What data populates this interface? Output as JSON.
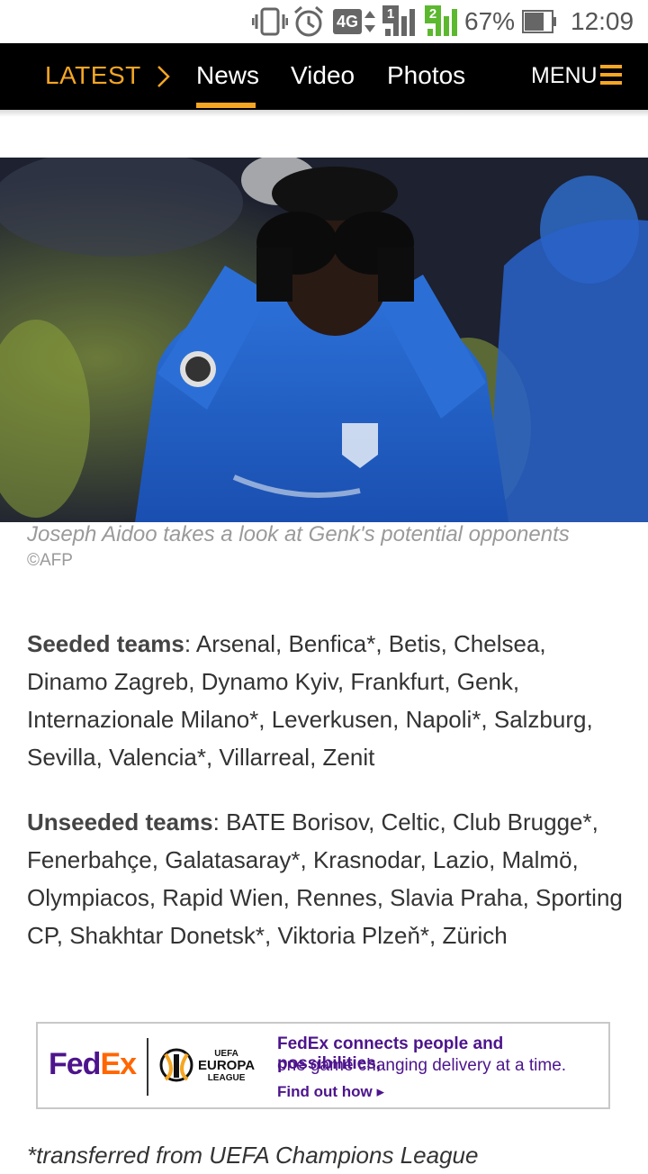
{
  "status_bar": {
    "battery_percent": "67%",
    "time": "12:09",
    "network": "4G",
    "sim1_badge": "1",
    "sim2_badge": "2",
    "icons": [
      "vibrate-icon",
      "alarm-icon",
      "network-4g-icon",
      "signal-sim1-icon",
      "signal-sim2-icon",
      "battery-icon"
    ]
  },
  "nav": {
    "latest": "LATEST",
    "tabs": [
      {
        "label": "News",
        "active": true
      },
      {
        "label": "Video",
        "active": false
      },
      {
        "label": "Photos",
        "active": false
      }
    ],
    "menu": "MENU",
    "accent_color": "#f5a623"
  },
  "hero": {
    "caption": "Joseph Aidoo takes a look at Genk's potential opponents",
    "credit": "©AFP"
  },
  "article": {
    "seeded_label": "Seeded teams",
    "seeded_text": ": Arsenal, Benfica*, Betis, Chelsea, Dinamo Zagreb, Dynamo Kyiv, Frankfurt, Genk, Internazionale Milano*, Leverkusen, Napoli*, Salzburg, Sevilla, Valencia*, Villarreal, Zenit",
    "unseeded_label": "Unseeded teams",
    "unseeded_text": ": BATE Borisov, Celtic, Club Brugge*, Fenerbahçe, Galatasaray*, Krasnodar, Lazio, Malmö, Olympiacos, Rapid Wien, Rennes, Slavia Praha, Sporting CP, Shakhtar Donetsk*, Viktoria Plzeň*, Zürich",
    "footnote": "*transferred from UEFA Champions League"
  },
  "ad": {
    "brand_fed": "Fed",
    "brand_ex": "Ex",
    "uel_small": "UEFA",
    "uel_big": "EUROPA",
    "uel_league": "LEAGUE",
    "headline": "FedEx connects people and possibilities,",
    "subline": "one game changing delivery at a time.",
    "cta": "Find out how ▸",
    "purple": "#4d148c",
    "orange": "#ff6600"
  }
}
